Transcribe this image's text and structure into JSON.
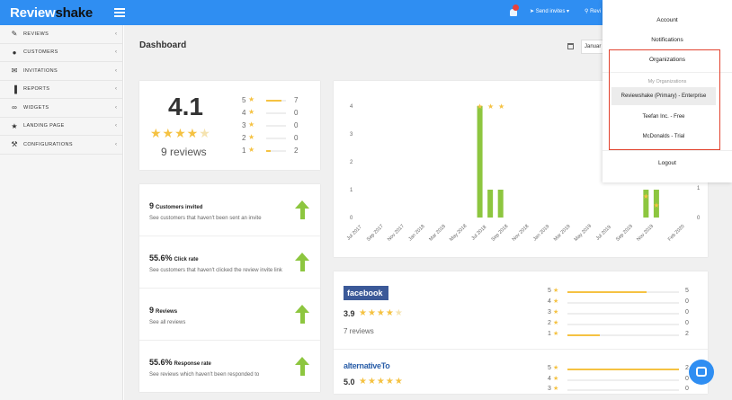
{
  "app": {
    "logo_main": "Review",
    "logo_accent": "shake"
  },
  "topbar": {
    "send_invites": "Send invites ▾",
    "reviews": "Revi"
  },
  "sidebar": {
    "items": [
      {
        "label": "REVIEWS",
        "icon": "pencil-icon"
      },
      {
        "label": "CUSTOMERS",
        "icon": "user-icon"
      },
      {
        "label": "INVITATIONS",
        "icon": "envelope-icon"
      },
      {
        "label": "REPORTS",
        "icon": "bar-chart-icon"
      },
      {
        "label": "WIDGETS",
        "icon": "link-icon"
      },
      {
        "label": "LANDING PAGE",
        "icon": "star-icon"
      },
      {
        "label": "CONFIGURATIONS",
        "icon": "wrench-icon"
      }
    ]
  },
  "main": {
    "title": "Dashboard",
    "date_value": "Januar"
  },
  "summary": {
    "rating": "4.1",
    "review_count": "9 reviews",
    "distribution": [
      {
        "stars": "5",
        "count": "7",
        "fraction": 0.78
      },
      {
        "stars": "4",
        "count": "0",
        "fraction": 0
      },
      {
        "stars": "3",
        "count": "0",
        "fraction": 0
      },
      {
        "stars": "2",
        "count": "0",
        "fraction": 0
      },
      {
        "stars": "1",
        "count": "2",
        "fraction": 0.22
      }
    ]
  },
  "stats": [
    {
      "value": "9",
      "unit": "Customers invited",
      "desc": "See customers that haven't been sent an invite"
    },
    {
      "value": "55.6%",
      "unit": "Click rate",
      "desc": "See customers that haven't clicked the review invite link"
    },
    {
      "value": "9",
      "unit": "Reviews",
      "desc": "See all reviews"
    },
    {
      "value": "55.6%",
      "unit": "Response rate",
      "desc": "See reviews which haven't been responded to"
    }
  ],
  "chart_data": {
    "type": "bar",
    "categories": [
      "Jul 2017",
      "Sep 2017",
      "Nov 2017",
      "Jan 2018",
      "Mar 2018",
      "May 2018",
      "Jul 2018",
      "Sep 2018",
      "Nov 2018",
      "Jan 2019",
      "Mar 2019",
      "May 2019",
      "Jul 2019",
      "Sep 2019",
      "Nov 2019",
      "Feb 2020"
    ],
    "bars": [
      {
        "x": "Jul 2018",
        "value": 4
      },
      {
        "x": "Aug 2018",
        "value": 1
      },
      {
        "x": "Sep 2018",
        "value": 1
      },
      {
        "x": "Nov 2019",
        "value": 1
      },
      {
        "x": "Dec 2019",
        "value": 1
      }
    ],
    "y_ticks_left": [
      "0",
      "1",
      "2",
      "3",
      "4"
    ],
    "y_ticks_right": [
      "0",
      "1"
    ],
    "ylim": [
      0,
      4
    ],
    "grid": false,
    "bar_color": "#8dc63f",
    "rating_color": "#f5c242"
  },
  "platforms": [
    {
      "name": "facebook",
      "rating": "3.9",
      "reviews": "7 reviews",
      "distribution": [
        {
          "stars": "5",
          "count": "5",
          "fraction": 0.71
        },
        {
          "stars": "4",
          "count": "0",
          "fraction": 0
        },
        {
          "stars": "3",
          "count": "0",
          "fraction": 0
        },
        {
          "stars": "2",
          "count": "0",
          "fraction": 0
        },
        {
          "stars": "1",
          "count": "2",
          "fraction": 0.29
        }
      ]
    },
    {
      "name": "alternativeTo",
      "rating": "5.0",
      "distribution": [
        {
          "stars": "5",
          "count": "2",
          "fraction": 1
        },
        {
          "stars": "4",
          "count": "0",
          "fraction": 0
        },
        {
          "stars": "3",
          "count": "0",
          "fraction": 0
        }
      ]
    }
  ],
  "dropdown": {
    "account": "Account",
    "notifications": "Notifications",
    "organizations": "Organizations",
    "my_orgs_header": "My Organizations",
    "orgs": [
      "Reviewshake (Primary) - Enterprise",
      "Teefan Inc. - Free",
      "McDonalds - Trial"
    ],
    "logout": "Logout"
  },
  "colors": {
    "primary": "#2f8ef2",
    "accent_green": "#8dc63f",
    "star": "#f5c242",
    "highlight_box": "#e2432f"
  }
}
